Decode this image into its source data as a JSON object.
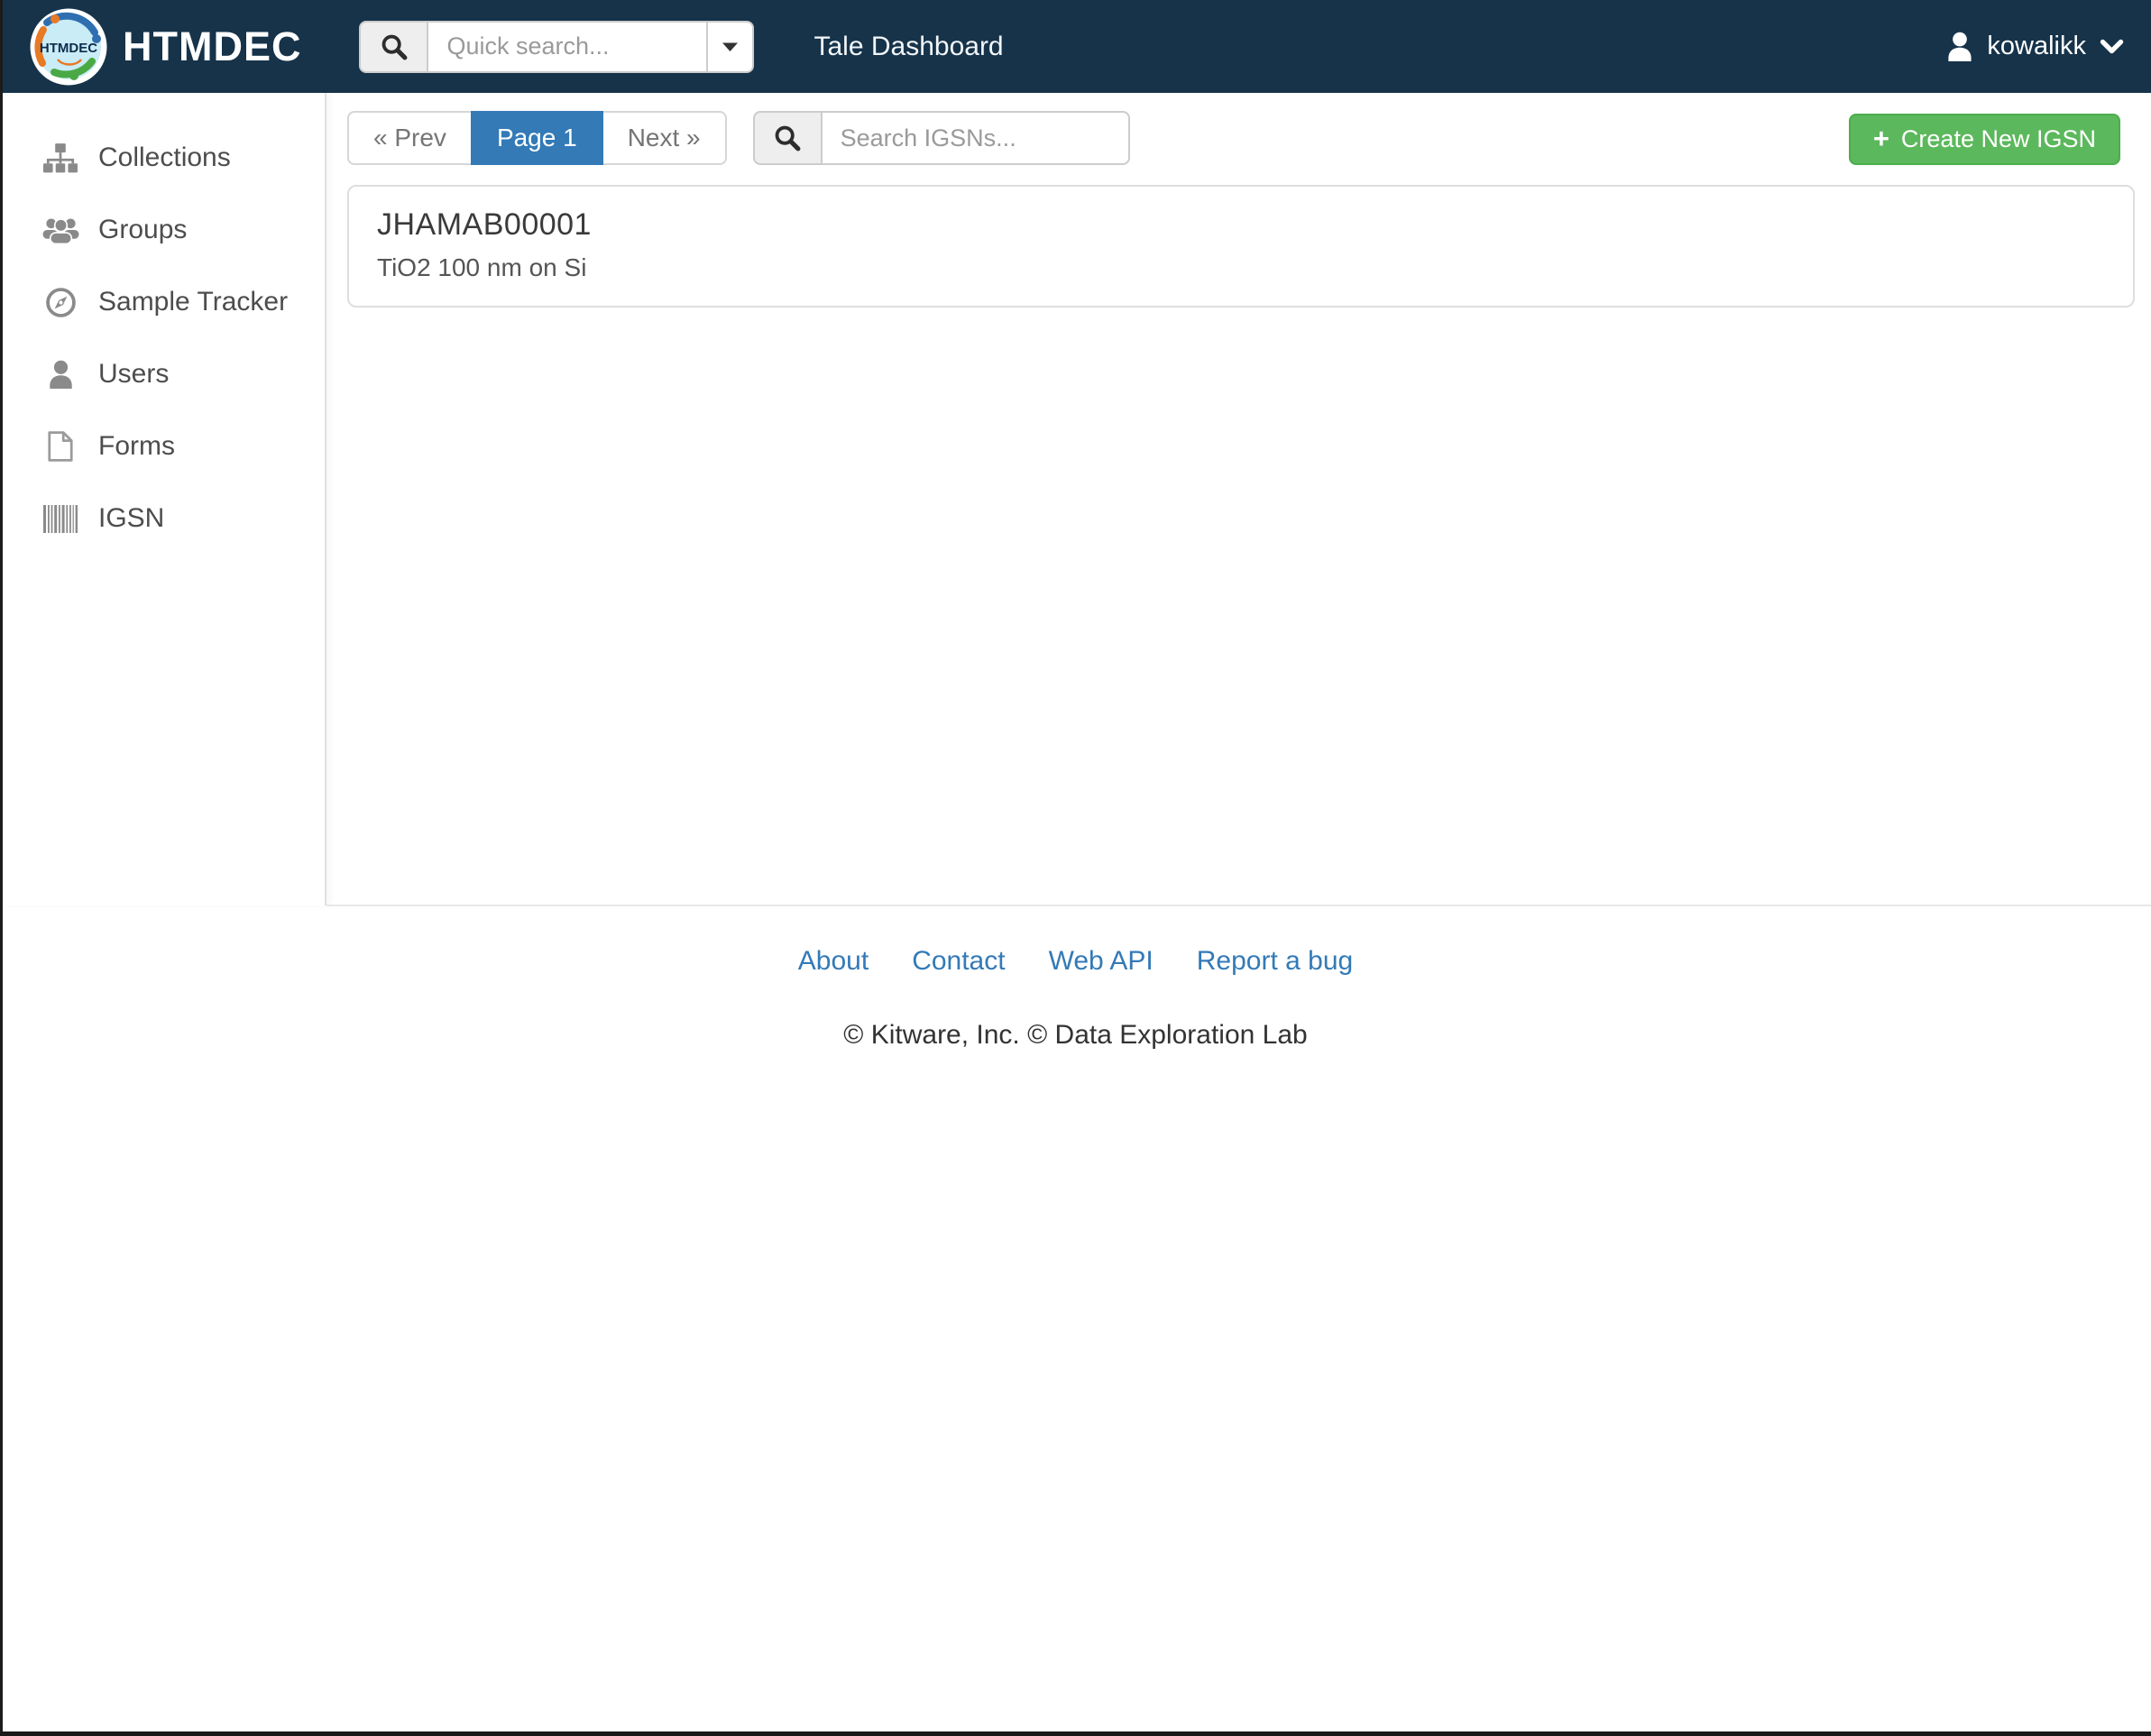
{
  "navbar": {
    "brand": "HTMDEC",
    "logo_text": "HTMDEC",
    "quick_search": {
      "placeholder": "Quick search..."
    },
    "links": [
      {
        "label": "Tale Dashboard"
      }
    ],
    "user": {
      "name": "kowalikk"
    }
  },
  "sidebar": {
    "items": [
      {
        "label": "Collections",
        "icon": "sitemap-icon"
      },
      {
        "label": "Groups",
        "icon": "users-icon"
      },
      {
        "label": "Sample Tracker",
        "icon": "compass-icon"
      },
      {
        "label": "Users",
        "icon": "user-icon"
      },
      {
        "label": "Forms",
        "icon": "file-icon"
      },
      {
        "label": "IGSN",
        "icon": "barcode-icon"
      }
    ]
  },
  "main": {
    "pagination": {
      "prev": "« Prev",
      "current": "Page 1",
      "next": "Next »"
    },
    "search": {
      "placeholder": "Search IGSNs..."
    },
    "create_button": {
      "plus": "+",
      "label": "Create New IGSN"
    },
    "igsns": [
      {
        "id": "JHAMAB00001",
        "description": "TiO2 100 nm on Si"
      }
    ]
  },
  "footer": {
    "links": [
      "About",
      "Contact",
      "Web API",
      "Report a bug"
    ],
    "copyright": "© Kitware, Inc. © Data Exploration Lab"
  },
  "colors": {
    "navbar_bg": "#16334a",
    "accent_blue": "#337ab7",
    "button_green": "#5cb85c",
    "button_green_border": "#4cae4c",
    "sidebar_text": "#4d4d4d",
    "icon_gray": "#8a8a8a"
  }
}
